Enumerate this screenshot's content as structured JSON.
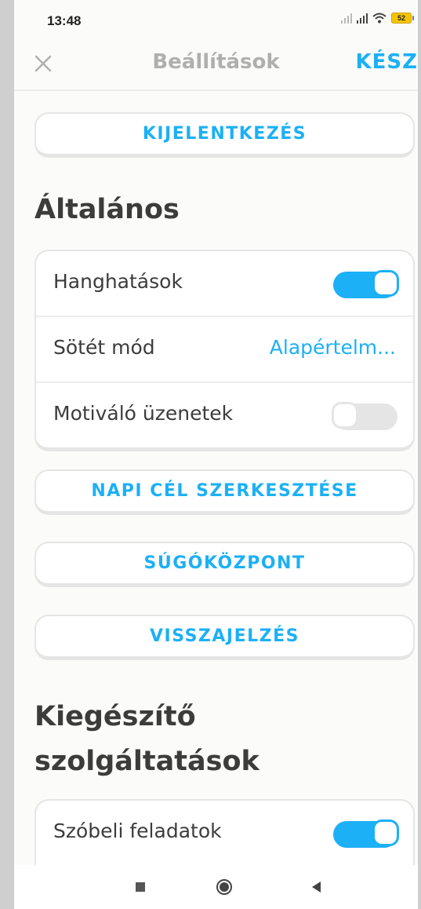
{
  "status_bar": {
    "time": "13:48",
    "battery": "52"
  },
  "header": {
    "title": "Beállítások",
    "done_label": "KÉSZ"
  },
  "buttons": {
    "logout": "KIJELENTKEZÉS",
    "daily_goal": "NAPI CÉL SZERKESZTÉSE",
    "help_center": "SÚGÓKÖZPONT",
    "feedback": "VISSZAJELZÉS"
  },
  "general": {
    "title": "Általános",
    "rows": [
      {
        "label": "Hanghatások",
        "toggle": true
      },
      {
        "label": "Sötét mód",
        "value": "Alapértelm..."
      },
      {
        "label": "Motiváló üzenetek",
        "toggle": false
      }
    ]
  },
  "additional": {
    "title_line1": "Kiegészítő",
    "title_line2": "szolgáltatások",
    "rows": [
      {
        "label": "Szóbeli feladatok",
        "toggle": true
      }
    ]
  },
  "colors": {
    "accent": "#1cb0f6",
    "toggle_off": "#e5e5e5",
    "text": "#3c3c3c",
    "muted": "#afafaf"
  }
}
